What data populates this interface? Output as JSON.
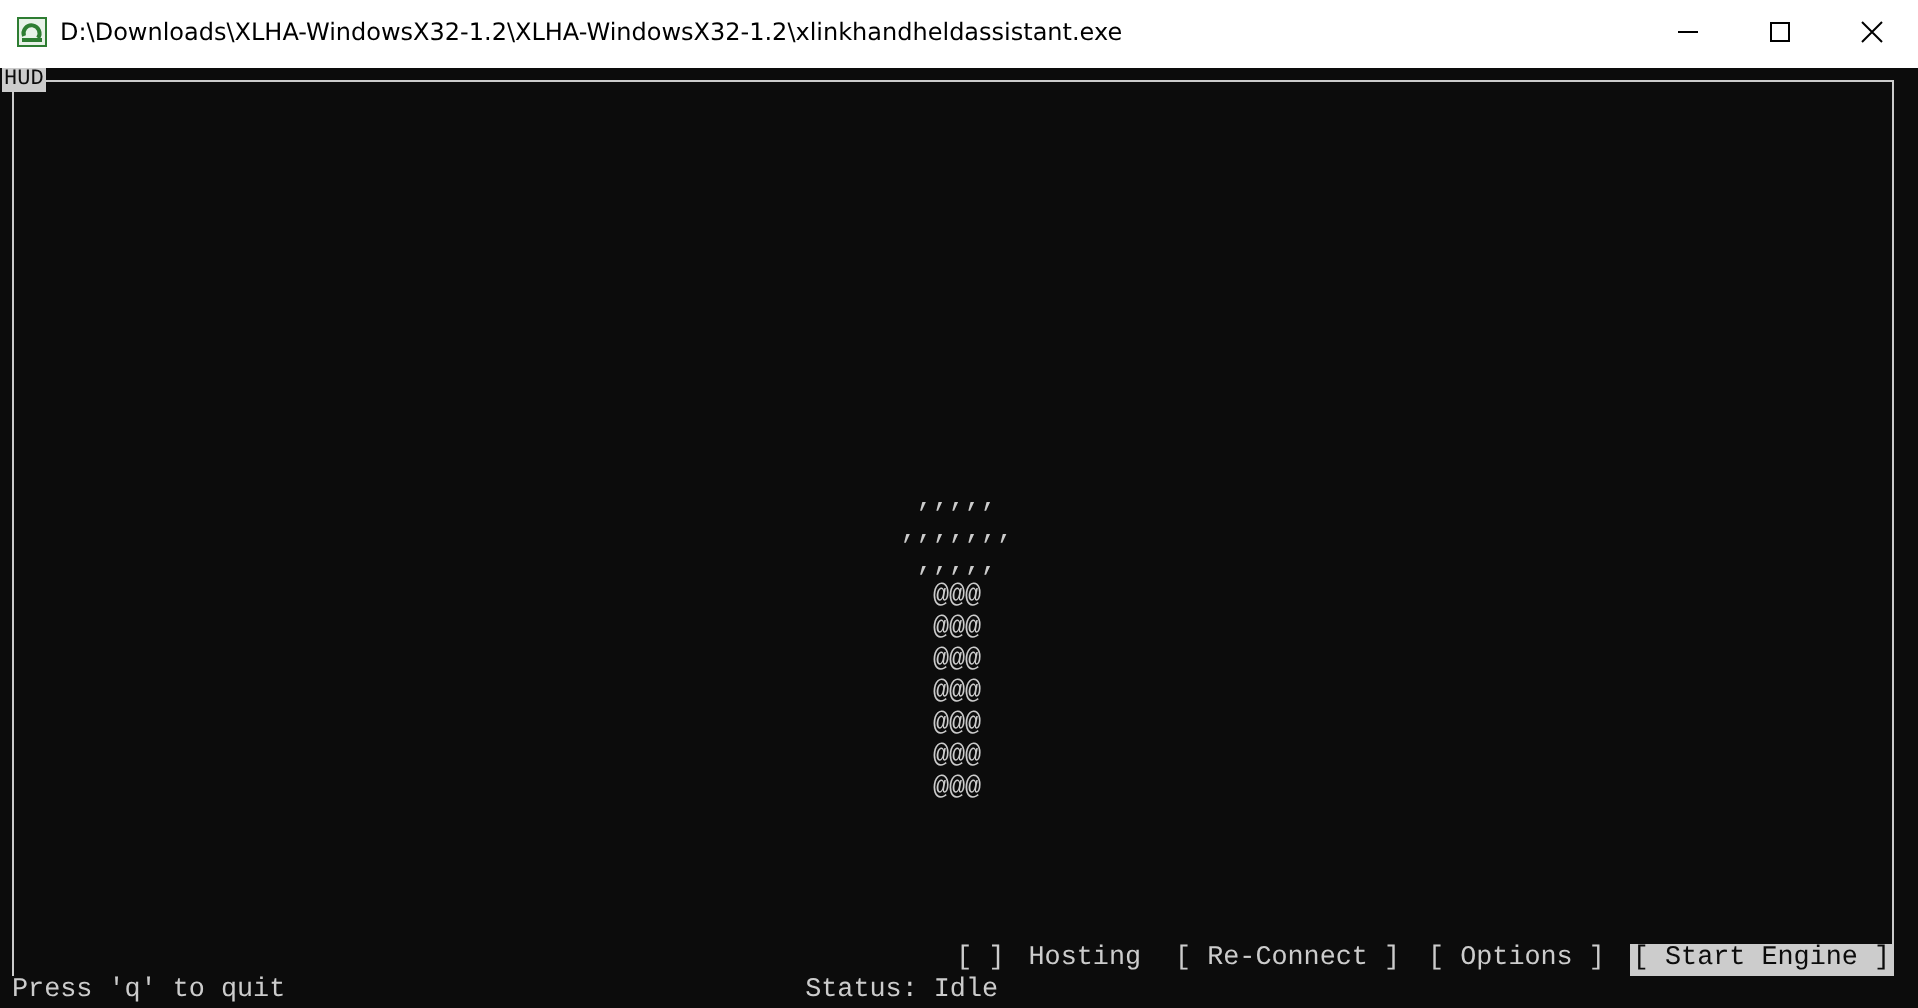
{
  "window": {
    "title": "D:\\Downloads\\XLHA-WindowsX32-1.2\\XLHA-WindowsX32-1.2\\xlinkhandheldassistant.exe"
  },
  "console": {
    "frame_label": "HUD",
    "art": [
      ",,,,,",
      ",,,,,,,",
      ",,,,,",
      "@@@",
      "@@@",
      "@@@",
      "@@@",
      "@@@",
      "@@@",
      "@@@"
    ],
    "controls": [
      {
        "kind": "checkbox",
        "box": "[ ]",
        "label": "Hosting",
        "checked": false
      },
      {
        "kind": "button",
        "label": "[ Re-Connect ]",
        "selected": false
      },
      {
        "kind": "button",
        "label": "[ Options ]",
        "selected": false
      },
      {
        "kind": "button",
        "label": "[ Start Engine ]",
        "selected": true
      }
    ],
    "hint": "Press 'q' to quit",
    "status": "Status: Idle"
  }
}
